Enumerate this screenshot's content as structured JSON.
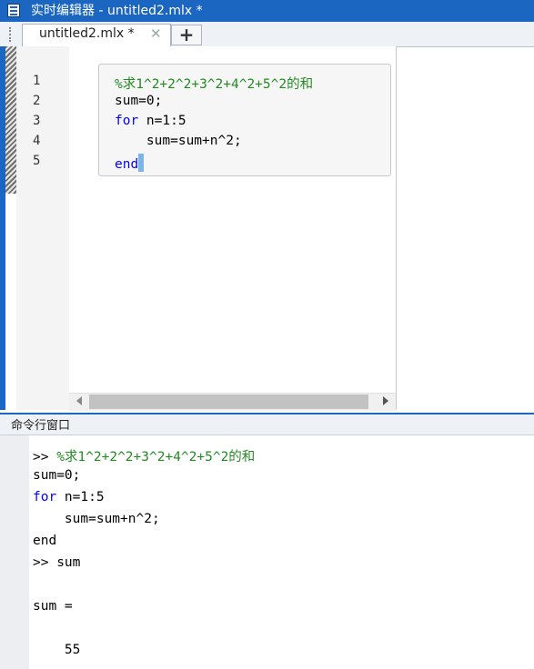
{
  "window": {
    "title": "实时编辑器 - untitled2.mlx *"
  },
  "tabs": [
    {
      "label": "untitled2.mlx *",
      "close": "✕"
    }
  ],
  "add_tab": "+",
  "editor": {
    "line_numbers": [
      "1",
      "2",
      "3",
      "4",
      "5"
    ],
    "code": {
      "l1_comment": "%求1^2+2^2+3^2+4^2+5^2的和",
      "l2": "sum=0;",
      "l3_kw": "for",
      "l3_rest": " n=1:5",
      "l4": "    sum=sum+n^2;",
      "l5_kw": "end"
    }
  },
  "command_window": {
    "title": "命令行窗口",
    "prompt1": ">> ",
    "comment": "%求1^2+2^2+3^2+4^2+5^2的和",
    "line2": "sum=0;",
    "line3_kw": "for",
    "line3_rest": " n=1:5",
    "line4": "    sum=sum+n^2;",
    "line5_kw": "end",
    "line6": ">> sum",
    "result_label": "sum =",
    "result_value": "    55"
  }
}
